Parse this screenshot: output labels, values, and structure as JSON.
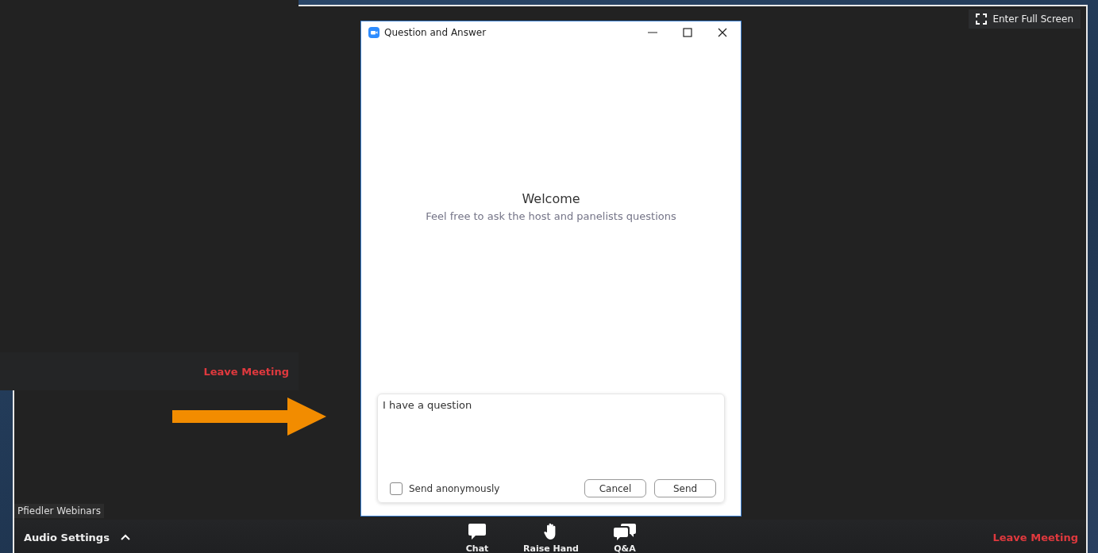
{
  "meeting_window": {
    "enter_full_screen": "Enter Full Screen",
    "name_label": "Pfiedler Webinars",
    "toolbar": {
      "audio_settings": "Audio Settings",
      "buttons": [
        {
          "kind": "chat",
          "label": "Chat"
        },
        {
          "kind": "raise_hand",
          "label": "Raise Hand"
        },
        {
          "kind": "qa",
          "label": "Q&A"
        }
      ],
      "leave": "Leave Meeting"
    }
  },
  "overlay_window": {
    "leave": "Leave Meeting"
  },
  "dialog": {
    "title": "Question and Answer",
    "welcome": "Welcome",
    "subtitle": "Feel free to ask the host and panelists questions",
    "question": {
      "value": "I have a question"
    },
    "anonymous": {
      "label": "Send anonymously",
      "checked": false
    },
    "buttons": [
      "Cancel",
      "Send"
    ]
  }
}
